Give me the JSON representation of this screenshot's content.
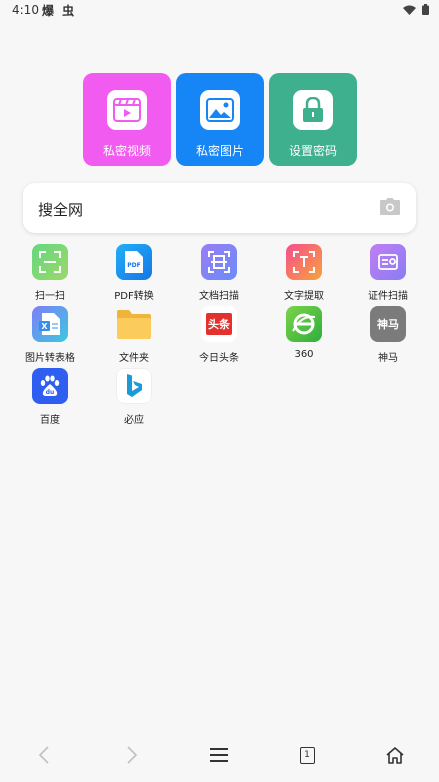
{
  "status_bar": {
    "time": "4:10",
    "app_glyphs": "爆 虫"
  },
  "quick_tiles": [
    {
      "label": "私密视频",
      "icon": "video-clapper-icon",
      "color": "#f25bf0"
    },
    {
      "label": "私密图片",
      "icon": "image-icon",
      "color": "#1686f7"
    },
    {
      "label": "设置密码",
      "icon": "lock-icon",
      "color": "#3eb08e"
    }
  ],
  "search": {
    "text": "搜全网",
    "icon": "camera-icon"
  },
  "shortcuts": [
    {
      "label": "扫一扫",
      "icon": "scan-icon"
    },
    {
      "label": "PDF转换",
      "icon": "pdf-icon"
    },
    {
      "label": "文档扫描",
      "icon": "doc-scan-icon"
    },
    {
      "label": "文字提取",
      "icon": "text-extract-icon"
    },
    {
      "label": "证件扫描",
      "icon": "id-scan-icon"
    },
    {
      "label": "图片转表格",
      "icon": "image-to-table-icon"
    },
    {
      "label": "文件夹",
      "icon": "folder-icon"
    },
    {
      "label": "今日头条",
      "icon": "toutiao-icon",
      "glyph": "头条"
    },
    {
      "label": "360",
      "icon": "browser-360-icon"
    },
    {
      "label": "神马",
      "icon": "shenma-icon",
      "glyph": "神马"
    },
    {
      "label": "百度",
      "icon": "baidu-icon"
    },
    {
      "label": "必应",
      "icon": "bing-icon"
    }
  ],
  "bottom_nav": {
    "tab_count": "1"
  }
}
